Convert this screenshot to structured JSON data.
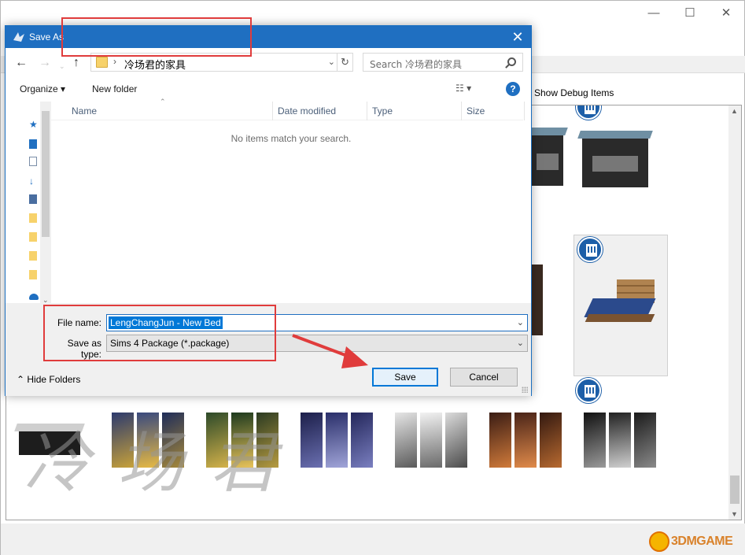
{
  "background_app": {
    "toolbar_label": "Show Debug Items",
    "window_controls": {
      "minimize": "—",
      "maximize": "☐",
      "close": "✕"
    },
    "watermark": "冷场君",
    "logo_text": "3DMGAME"
  },
  "dialog": {
    "title": "Save As",
    "close": "✕",
    "nav": {
      "back": "←",
      "forward": "→",
      "recent": "⌄",
      "up": "↑",
      "separator": "›",
      "current_folder": "冷场君的家具",
      "address_dropdown": "⌄",
      "refresh": "↻"
    },
    "search": {
      "placeholder": "Search 冷场君的家具"
    },
    "commands": {
      "organize": "Organize ▾",
      "new_folder": "New folder",
      "view": "☷ ▾",
      "help": "?"
    },
    "columns": [
      {
        "label": "Name"
      },
      {
        "label": "Date modified"
      },
      {
        "label": "Type"
      },
      {
        "label": "Size"
      }
    ],
    "empty_message": "No items match your search.",
    "filename": {
      "label": "File name:",
      "value": "LengChangJun - New Bed",
      "dropdown": "⌄"
    },
    "save_as_type": {
      "label": "Save as type:",
      "value": "Sims 4 Package (*.package)",
      "dropdown": "⌄"
    },
    "hide_folders": "⌃  Hide Folders",
    "save_label": "Save",
    "cancel_label": "Cancel"
  },
  "colors": {
    "titlebar": "#1f6fc1",
    "annotation": "#e03c3c",
    "badge": "#1d5fa8",
    "selection": "#0078d7"
  }
}
